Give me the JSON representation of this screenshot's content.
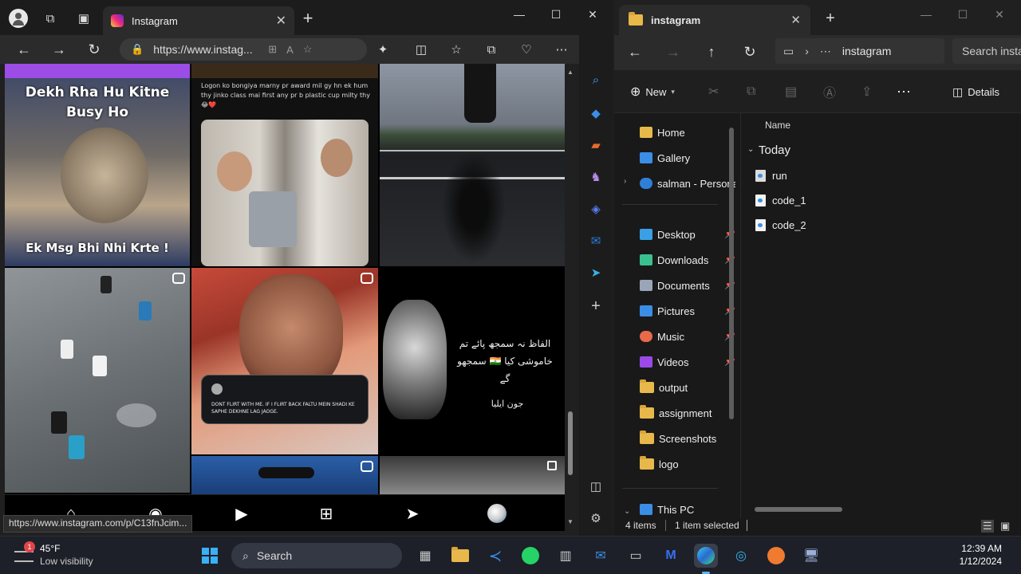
{
  "edge": {
    "tab_title": "Instagram",
    "url": "https://www.instag...",
    "status_url": "https://www.instagram.com/p/C13fnJcim...",
    "posts": {
      "p1_top": "Dekh Rha Hu Kitne Busy Ho",
      "p1_bottom": "Ek Msg Bhi Nhi Krte !",
      "p2_caption": "Logon ko bongiya marny pr award mil gy hn ek hum thy jinko class mai first any pr b plastic cup milty thy😂❤️",
      "p5_tweet": "DONT FLIRT WITH ME. IF I FLIRT BACK FALTU MEIN SHADI KE SAPHE DEKHNE LAG JAOGE.",
      "p6_urdu_1": "الفاظ نہ سمجھ پائے تم",
      "p6_urdu_2": "خاموشی کیا 🇮🇳 سمجھو گے",
      "p6_urdu_3": "جون ایلیا"
    }
  },
  "explorer": {
    "tab_title": "instagram",
    "path_label": "instagram",
    "search_placeholder": "Search insta",
    "new_label": "New",
    "details_label": "Details",
    "column_name": "Name",
    "group_today": "Today",
    "files": [
      "run",
      "code_1",
      "code_2"
    ],
    "nav_top": [
      {
        "label": "Home",
        "color": "#e8b84a"
      },
      {
        "label": "Gallery",
        "color": "#3a8ee6"
      },
      {
        "label": "salman - Personal",
        "color": "#2f7fd8"
      }
    ],
    "nav_quick": [
      {
        "label": "Desktop",
        "color": "#3aa0e6",
        "pinned": true
      },
      {
        "label": "Downloads",
        "color": "#3ac08e",
        "pinned": true
      },
      {
        "label": "Documents",
        "color": "#9aa6b8",
        "pinned": true
      },
      {
        "label": "Pictures",
        "color": "#3a8ee6",
        "pinned": true
      },
      {
        "label": "Music",
        "color": "#e86a4a",
        "pinned": true
      },
      {
        "label": "Videos",
        "color": "#9a4ae8",
        "pinned": true
      },
      {
        "label": "output",
        "color": "#e8b84a",
        "pinned": false
      },
      {
        "label": "assignment",
        "color": "#e8b84a",
        "pinned": false
      },
      {
        "label": "Screenshots",
        "color": "#e8b84a",
        "pinned": false
      },
      {
        "label": "logo",
        "color": "#e8b84a",
        "pinned": false
      }
    ],
    "nav_bottom": "This PC",
    "status_items": "4 items",
    "status_selected": "1 item selected"
  },
  "taskbar": {
    "weather_temp": "45°F",
    "weather_desc": "Low visibility",
    "weather_badge": "1",
    "search_label": "Search",
    "time": "12:39 AM",
    "date": "1/12/2024"
  }
}
